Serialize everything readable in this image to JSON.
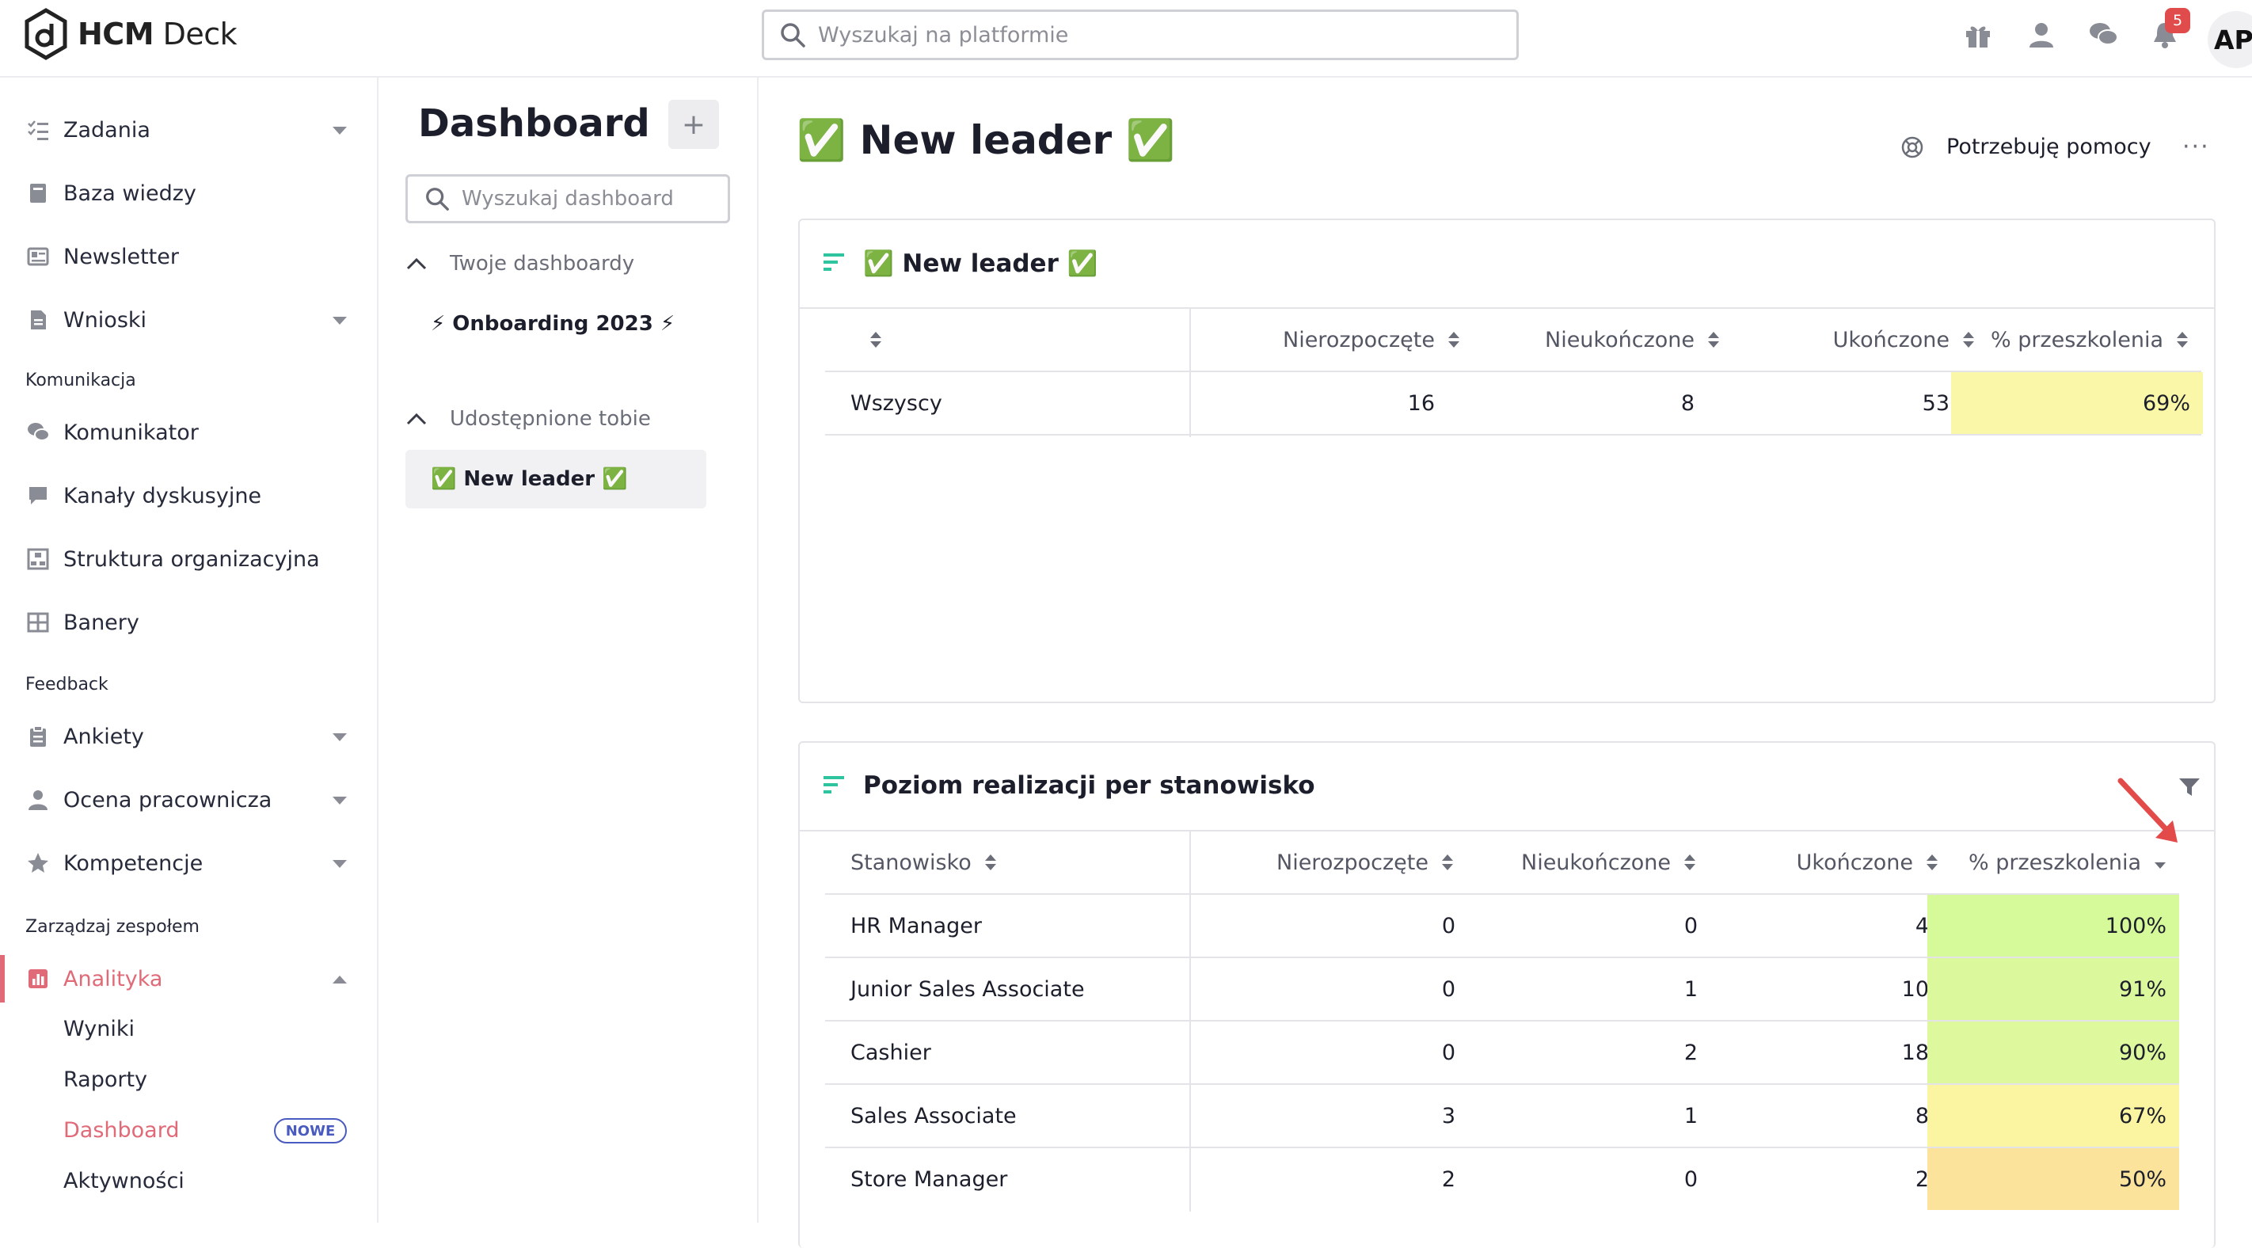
{
  "app": {
    "name_bold": "HCM",
    "name_rest": " Deck"
  },
  "search": {
    "placeholder": "Wyszukaj na platformie"
  },
  "topbar": {
    "icons": [
      "gift-icon",
      "user-icon",
      "chat-icon",
      "bell-icon"
    ],
    "notification_count": "5",
    "avatar_initials": "AP"
  },
  "sidebar": {
    "items": [
      {
        "label": "Zadania",
        "icon": "tasks-icon",
        "expandable": true
      },
      {
        "label": "Baza wiedzy",
        "icon": "book-icon",
        "expandable": false
      },
      {
        "label": "Newsletter",
        "icon": "newsletter-icon",
        "expandable": false
      },
      {
        "label": "Wnioski",
        "icon": "document-icon",
        "expandable": true
      }
    ],
    "section_komunikacja": "Komunikacja",
    "komunikacja_items": [
      {
        "label": "Komunikator",
        "icon": "chat-icon"
      },
      {
        "label": "Kanały dyskusyjne",
        "icon": "comment-icon"
      },
      {
        "label": "Struktura organizacyjna",
        "icon": "org-structure-icon"
      },
      {
        "label": "Banery",
        "icon": "grid-icon"
      }
    ],
    "section_feedback": "Feedback",
    "feedback_items": [
      {
        "label": "Ankiety",
        "icon": "clipboard-icon",
        "expandable": true
      },
      {
        "label": "Ocena pracownicza",
        "icon": "employee-rating-icon",
        "expandable": true
      },
      {
        "label": "Kompetencje",
        "icon": "star-icon",
        "expandable": true
      }
    ],
    "section_zespol": "Zarządzaj zespołem",
    "analityka": {
      "label": "Analityka",
      "icon": "chart-icon"
    },
    "analityka_sub": [
      "Wyniki",
      "Raporty",
      "Dashboard",
      "Aktywności"
    ],
    "new_badge": "NOWE"
  },
  "dashboards": {
    "title": "Dashboard",
    "add_label": "+",
    "search_placeholder": "Wyszukaj dashboard",
    "group_own": "Twoje dashboardy",
    "own_items": [
      "⚡ Onboarding 2023 ⚡"
    ],
    "group_shared": "Udostępnione tobie",
    "shared_items": [
      "✅ New leader ✅"
    ]
  },
  "main": {
    "title": "✅ New leader ✅",
    "help_label": "Potrzebuję pomocy",
    "more_label": "···"
  },
  "card1": {
    "title": "✅ New leader ✅",
    "headers": [
      "",
      "Nierozpoczęte",
      "Nieukończone",
      "Ukończone",
      "% przeszkolenia"
    ],
    "rows": [
      {
        "name": "Wszyscy",
        "not_started": "16",
        "unfinished": "8",
        "completed": "53",
        "pct": "69%",
        "pct_color": "#fbf7a8"
      }
    ]
  },
  "card2": {
    "title": "Poziom realizacji per stanowisko",
    "headers": [
      "Stanowisko",
      "Nierozpoczęte",
      "Nieukończone",
      "Ukończone",
      "% przeszkolenia"
    ],
    "rows": [
      {
        "name": "HR Manager",
        "not_started": "0",
        "unfinished": "0",
        "completed": "4",
        "pct": "100%",
        "pct_color": "#d6f99a"
      },
      {
        "name": "Junior Sales Associate",
        "not_started": "0",
        "unfinished": "1",
        "completed": "10",
        "pct": "91%",
        "pct_color": "#dcf89d"
      },
      {
        "name": "Cashier",
        "not_started": "0",
        "unfinished": "2",
        "completed": "18",
        "pct": "90%",
        "pct_color": "#def89e"
      },
      {
        "name": "Sales Associate",
        "not_started": "3",
        "unfinished": "1",
        "completed": "8",
        "pct": "67%",
        "pct_color": "#fbf5a2"
      },
      {
        "name": "Store Manager",
        "not_started": "2",
        "unfinished": "0",
        "completed": "2",
        "pct": "50%",
        "pct_color": "#fbe39c"
      }
    ]
  },
  "colors": {
    "accent": "#e06a78",
    "teal": "#2ec4a0",
    "arrow": "#e34a4a"
  }
}
